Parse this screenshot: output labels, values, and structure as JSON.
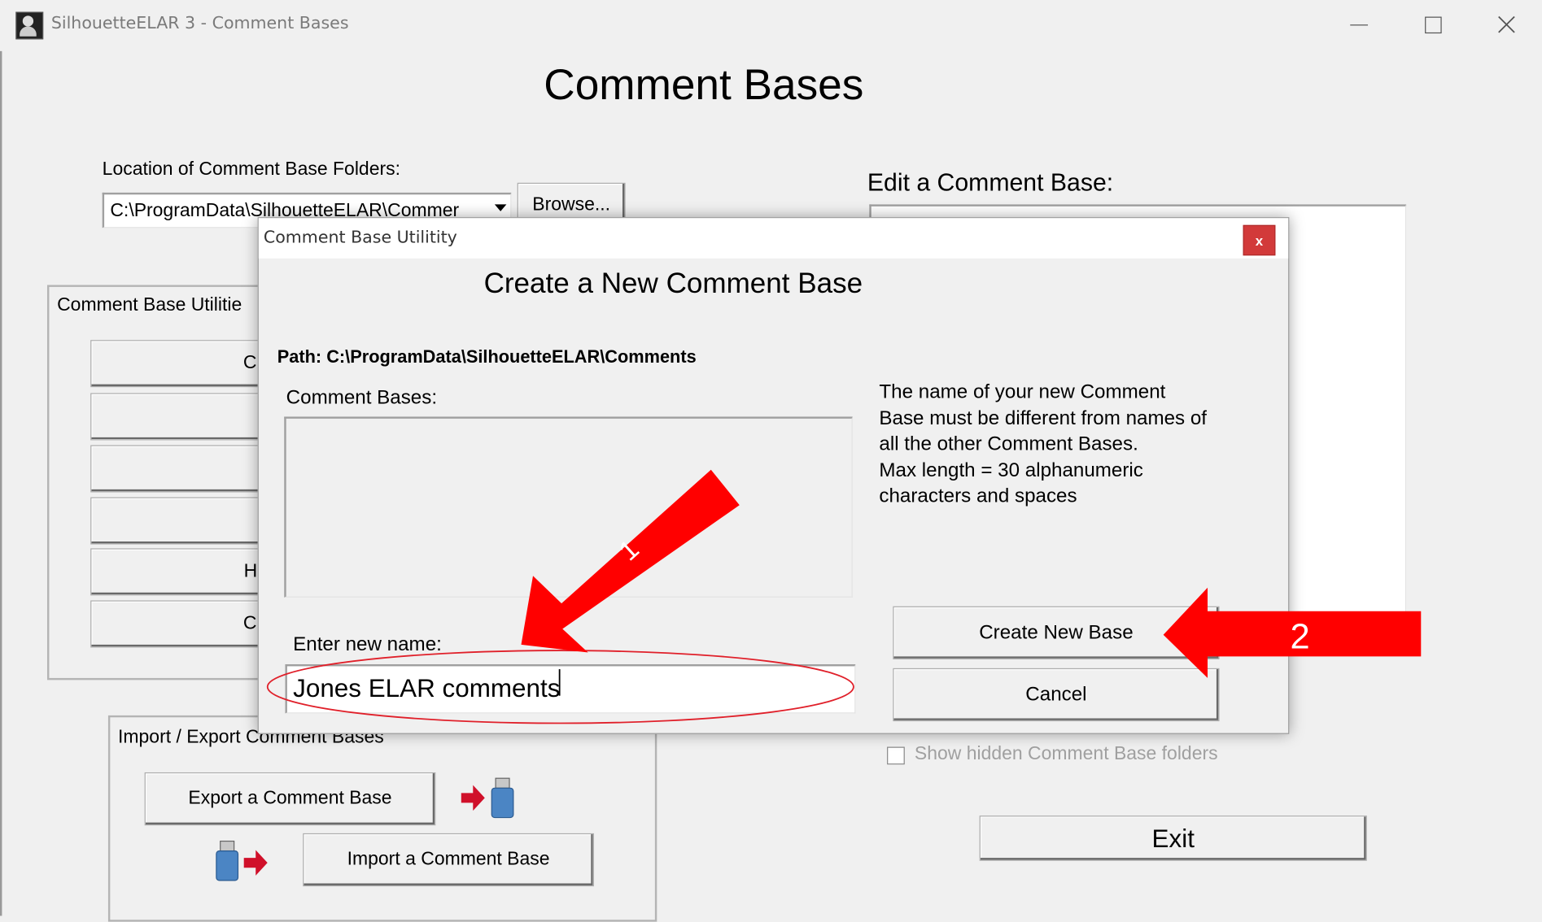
{
  "window": {
    "title": "SilhouetteELAR 3 - Comment Bases",
    "minimize_icon": "minimize-icon",
    "maximize_icon": "maximize-icon",
    "close_icon": "close-icon"
  },
  "main": {
    "heading": "Comment Bases",
    "location_label": "Location of Comment Base Folders:",
    "location_value": "C:\\ProgramData\\SilhouetteELAR\\Commer",
    "browse_label": "Browse...",
    "edit_label": "Edit a Comment Base:",
    "utilities_group_label": "Comment Base Utilitie",
    "utility_buttons": [
      "C",
      "",
      "",
      "",
      "Hide",
      "C"
    ],
    "import_export_label": "Import / Export Comment Bases",
    "export_label": "Export a Comment Base",
    "import_label": "Import a Comment Base",
    "show_hidden_label": "Show hidden Comment Base folders",
    "exit_label": "Exit"
  },
  "dialog": {
    "title": "Comment Base Utilitity",
    "close_glyph": "x",
    "heading": "Create a New Comment Base",
    "path_text": "Path: C:\\ProgramData\\SilhouetteELAR\\Comments",
    "comment_bases_label": "Comment Bases:",
    "help_lines": [
      "The name of your new Comment",
      "Base must be different from names of",
      "all the other Comment Bases.",
      "Max length = 30 alphanumeric",
      "characters and spaces"
    ],
    "enter_name_label": "Enter new name:",
    "name_value": "Jones ELAR comments",
    "create_label": "Create New Base",
    "cancel_label": "Cancel"
  },
  "annotations": {
    "arrow1_label": "1",
    "arrow2_label": "2",
    "accent": "#ff0000"
  }
}
